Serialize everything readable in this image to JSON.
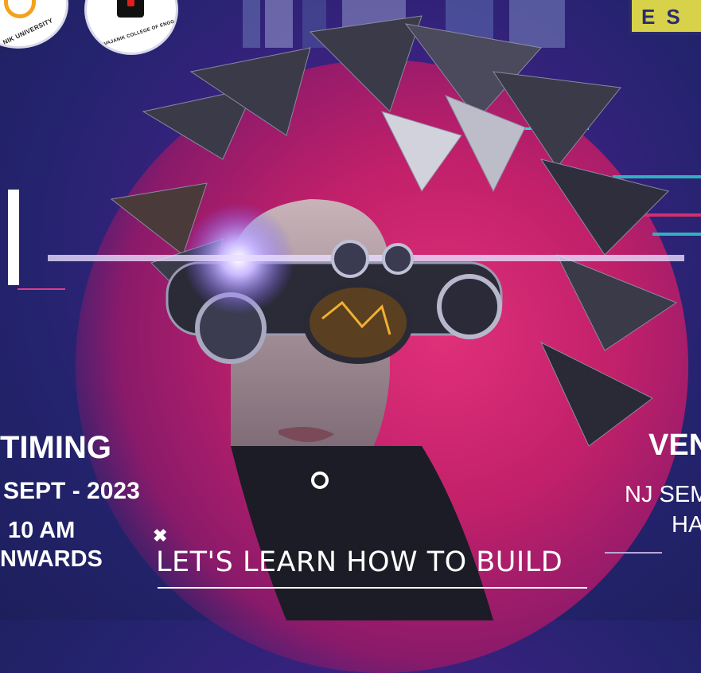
{
  "logos": {
    "left_logo_text": "NIK UNIVERSITY",
    "center_logo_text": "SARVAJANIK COLLEGE OF ENGG. & TECH.",
    "right_badge_text": "ES"
  },
  "timing": {
    "title": "TIMING",
    "date": "SEPT - 2023",
    "time": "10 AM",
    "onwards": "NWARDS"
  },
  "venue": {
    "title": "VEN",
    "place": "NJ SEM",
    "hall": "HA"
  },
  "tagline": "LET'S LEARN HOW TO BUILD",
  "colors": {
    "background": "#24236e",
    "accent_pink": "#e0307a",
    "accent_yellow": "#d7d24a",
    "text": "#ffffff"
  },
  "icons": [
    "close-icon",
    "ring-icon"
  ]
}
